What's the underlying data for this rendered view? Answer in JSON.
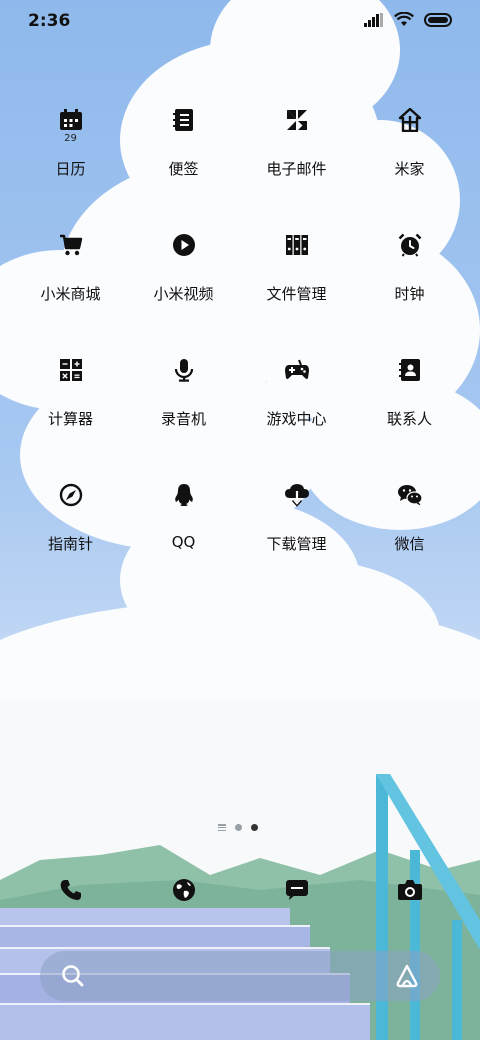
{
  "status_bar": {
    "time": "2:36"
  },
  "apps": [
    {
      "label": "日历",
      "icon": "calendar-icon",
      "date": "29"
    },
    {
      "label": "便签",
      "icon": "notes-icon"
    },
    {
      "label": "电子邮件",
      "icon": "email-icon"
    },
    {
      "label": "米家",
      "icon": "mijia-home-icon"
    },
    {
      "label": "小米商城",
      "icon": "shopping-cart-icon"
    },
    {
      "label": "小米视频",
      "icon": "video-play-icon"
    },
    {
      "label": "文件管理",
      "icon": "file-manager-icon"
    },
    {
      "label": "时钟",
      "icon": "alarm-clock-icon"
    },
    {
      "label": "计算器",
      "icon": "calculator-icon"
    },
    {
      "label": "录音机",
      "icon": "microphone-icon"
    },
    {
      "label": "游戏中心",
      "icon": "gamepad-icon"
    },
    {
      "label": "联系人",
      "icon": "contacts-icon"
    },
    {
      "label": "指南针",
      "icon": "compass-icon"
    },
    {
      "label": "QQ",
      "icon": "qq-penguin-icon"
    },
    {
      "label": "下载管理",
      "icon": "download-cloud-icon"
    },
    {
      "label": "微信",
      "icon": "wechat-icon"
    }
  ],
  "page_indicator": {
    "pages": 3,
    "active_page": 3
  },
  "dock": [
    {
      "icon": "phone-icon"
    },
    {
      "icon": "browser-globe-icon"
    },
    {
      "icon": "messages-icon"
    },
    {
      "icon": "camera-icon"
    }
  ],
  "search_bar": {
    "icon": "search-icon",
    "brand_icon": "xiaoai-icon"
  },
  "colors": {
    "icon": "#111111",
    "text": "#111111",
    "sky": "#8fb9ec"
  }
}
